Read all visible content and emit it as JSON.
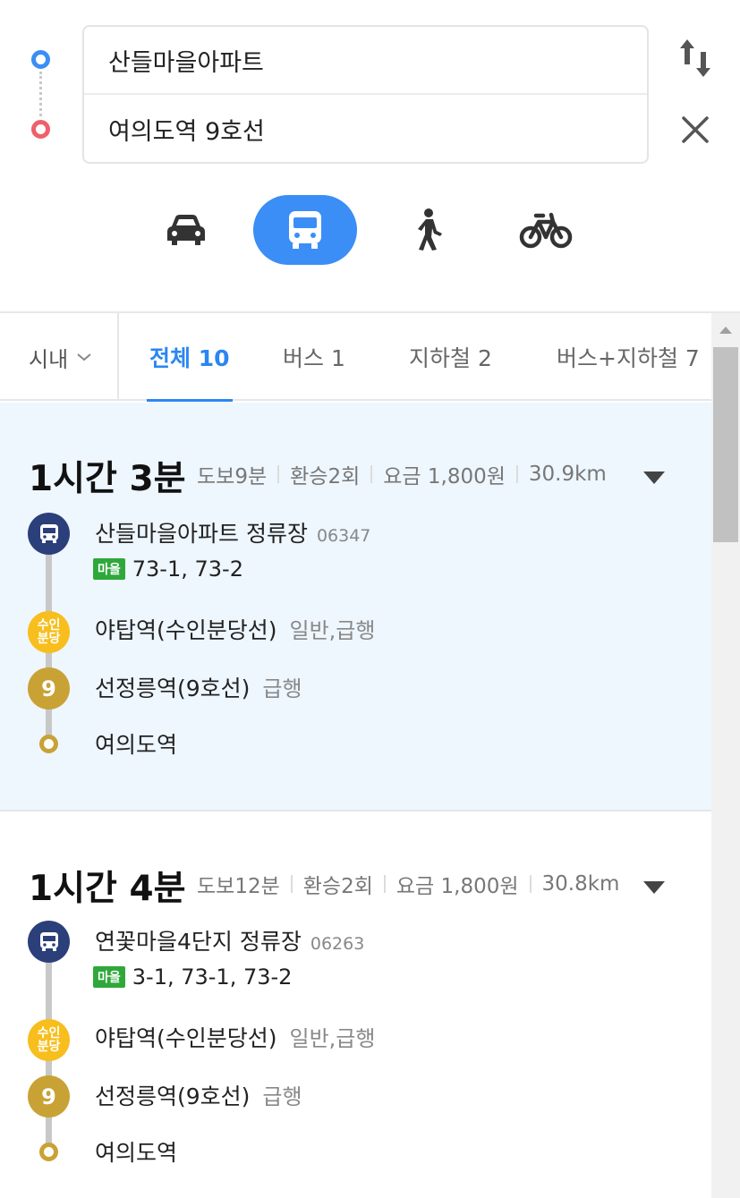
{
  "search": {
    "origin": "산들마을아파트",
    "destination": "여의도역 9호선"
  },
  "modes": [
    {
      "name": "car-icon",
      "active": false
    },
    {
      "name": "transit-bus-icon",
      "active": true
    },
    {
      "name": "walk-icon",
      "active": false
    },
    {
      "name": "bike-icon",
      "active": false
    }
  ],
  "filters": {
    "region": "시내",
    "tabs": [
      {
        "label": "전체 10",
        "active": true
      },
      {
        "label": "버스 1",
        "active": false
      },
      {
        "label": "지하철 2",
        "active": false
      },
      {
        "label": "버스+지하철 7",
        "active": false
      }
    ]
  },
  "routes": [
    {
      "duration": "1시간 3분",
      "walk": "도보9분",
      "transfers": "환승2회",
      "fare": "요금 1,800원",
      "distance": "30.9km",
      "steps": [
        {
          "type": "bus",
          "name": "산들마을아파트 정류장",
          "sub": "06347"
        },
        {
          "type": "bus-lines",
          "badge": "마을",
          "lines": "73-1, 73-2"
        },
        {
          "type": "suin",
          "icon_text": "수인\n분당",
          "name": "야탑역(수인분당선)",
          "tag": "일반,급행"
        },
        {
          "type": "line9",
          "icon_text": "9",
          "name": "선정릉역(9호선)",
          "tag": "급행"
        },
        {
          "type": "end",
          "name": "여의도역"
        }
      ]
    },
    {
      "duration": "1시간 4분",
      "walk": "도보12분",
      "transfers": "환승2회",
      "fare": "요금 1,800원",
      "distance": "30.8km",
      "steps": [
        {
          "type": "bus",
          "name": "연꽃마을4단지 정류장",
          "sub": "06263"
        },
        {
          "type": "bus-lines",
          "badge": "마을",
          "lines": "3-1, 73-1, 73-2"
        },
        {
          "type": "suin",
          "icon_text": "수인\n분당",
          "name": "야탑역(수인분당선)",
          "tag": "일반,급행"
        },
        {
          "type": "line9",
          "icon_text": "9",
          "name": "선정릉역(9호선)",
          "tag": "급행"
        },
        {
          "type": "end",
          "name": "여의도역"
        }
      ]
    }
  ],
  "colors": {
    "accent": "#3a8ef6",
    "origin": "#3a8ef6",
    "destination": "#f0606a",
    "bus": "#2b3f7a",
    "suin_bundang": "#f7be1d",
    "line9": "#c9a235",
    "village_bus": "#2fa83b",
    "highlight_bg": "#eef6fe"
  }
}
